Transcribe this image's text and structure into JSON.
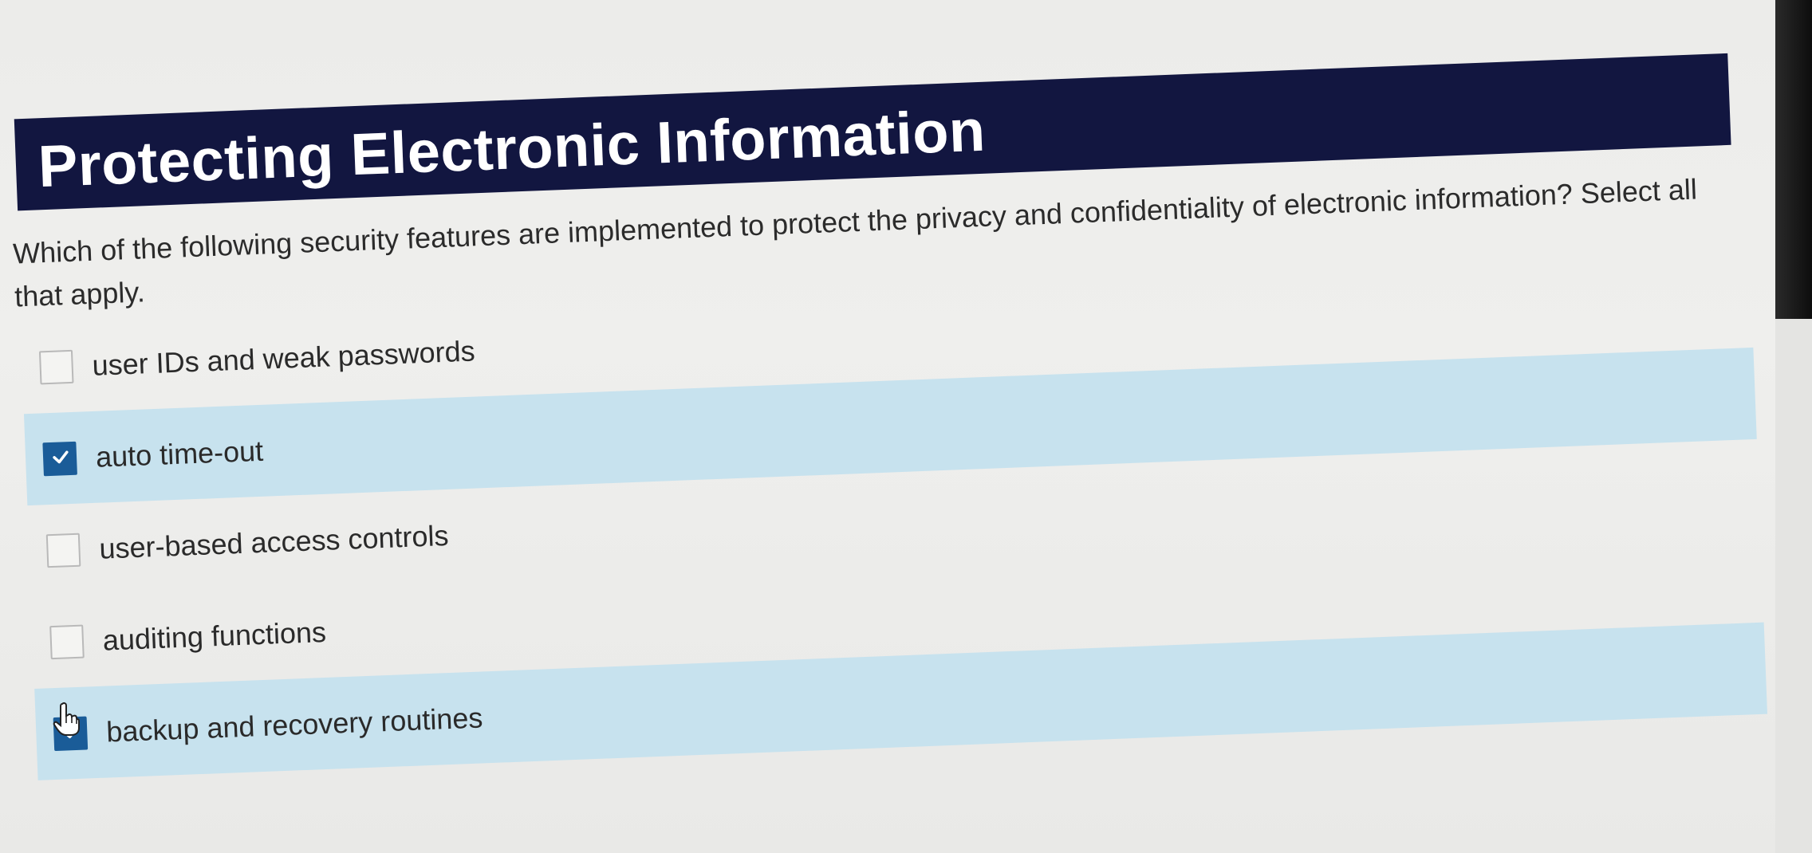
{
  "page": {
    "title": "Protecting Electronic Information",
    "question": "Which of the following security features are implemented to protect the privacy and confidentiality of electronic information? Select all that apply."
  },
  "options": [
    {
      "label": "user IDs and weak passwords",
      "checked": false
    },
    {
      "label": "auto time-out",
      "checked": true
    },
    {
      "label": "user-based access controls",
      "checked": false
    },
    {
      "label": "auditing functions",
      "checked": false
    },
    {
      "label": "backup and recovery routines",
      "checked": true
    }
  ],
  "colors": {
    "title_bar": "#121640",
    "selected_row": "#c7e2ee",
    "checkbox_checked": "#1a5c98"
  },
  "icons": {
    "checkmark": "checkmark-icon",
    "cursor": "hand-pointer-icon"
  }
}
